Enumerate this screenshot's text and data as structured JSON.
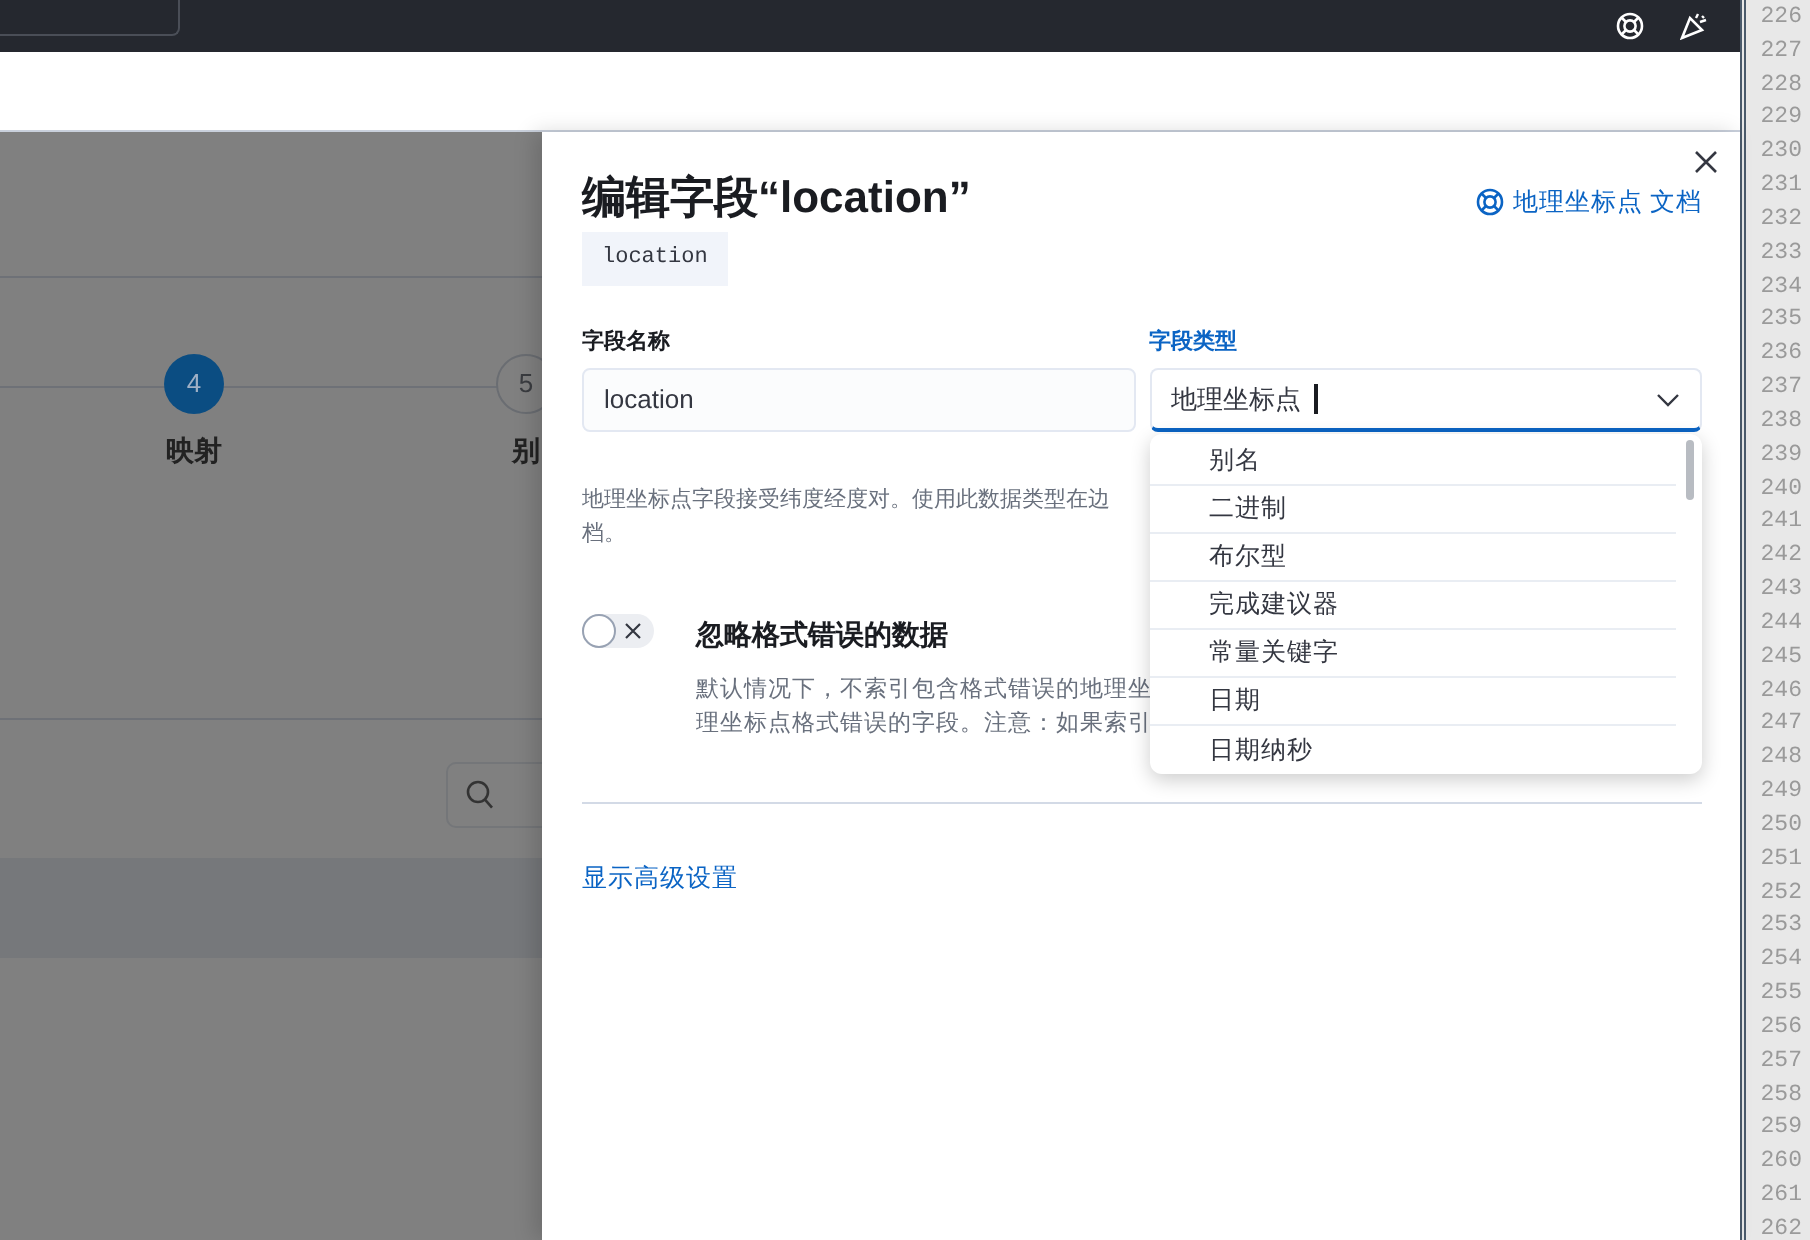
{
  "background_page": {
    "steps": [
      {
        "number": "4",
        "label": "映射",
        "selected": true
      },
      {
        "number": "5",
        "label": "别",
        "selected": false
      }
    ]
  },
  "flyout": {
    "title": "编辑字段“location”",
    "docs_link": "地理坐标点 文档",
    "field_badge": "location",
    "name_field": {
      "label": "字段名称",
      "value": "location",
      "focused": false
    },
    "type_field": {
      "label": "字段类型",
      "value": "地理坐标点",
      "focused": true
    },
    "description_lines": [
      "地理坐标点字段接受纬度经度对。使用此数据类型在边",
      "档。"
    ],
    "toggle": {
      "label": "忽略格式错误的数据",
      "on": false,
      "description_lines": [
        "默认情况下，不索引包含格式错误的地理坐",
        "理坐标点格式错误的字段。注意：如果索引"
      ]
    },
    "advanced_link": "显示高级设置",
    "type_options": [
      {
        "label": "别名"
      },
      {
        "label": "二进制"
      },
      {
        "label": "布尔型"
      },
      {
        "label": "完成建议器"
      },
      {
        "label": "常量关键字"
      },
      {
        "label": "日期"
      },
      {
        "label": "日期纳秒"
      }
    ]
  },
  "line_numbers": [
    "226",
    "227",
    "228",
    "229",
    "230",
    "231",
    "232",
    "233",
    "234",
    "235",
    "236",
    "237",
    "238",
    "239",
    "240",
    "241",
    "242",
    "243",
    "244",
    "245",
    "246",
    "247",
    "248",
    "249",
    "250",
    "251",
    "252",
    "253",
    "254",
    "255",
    "256",
    "257",
    "258",
    "259",
    "260",
    "261",
    "262"
  ]
}
